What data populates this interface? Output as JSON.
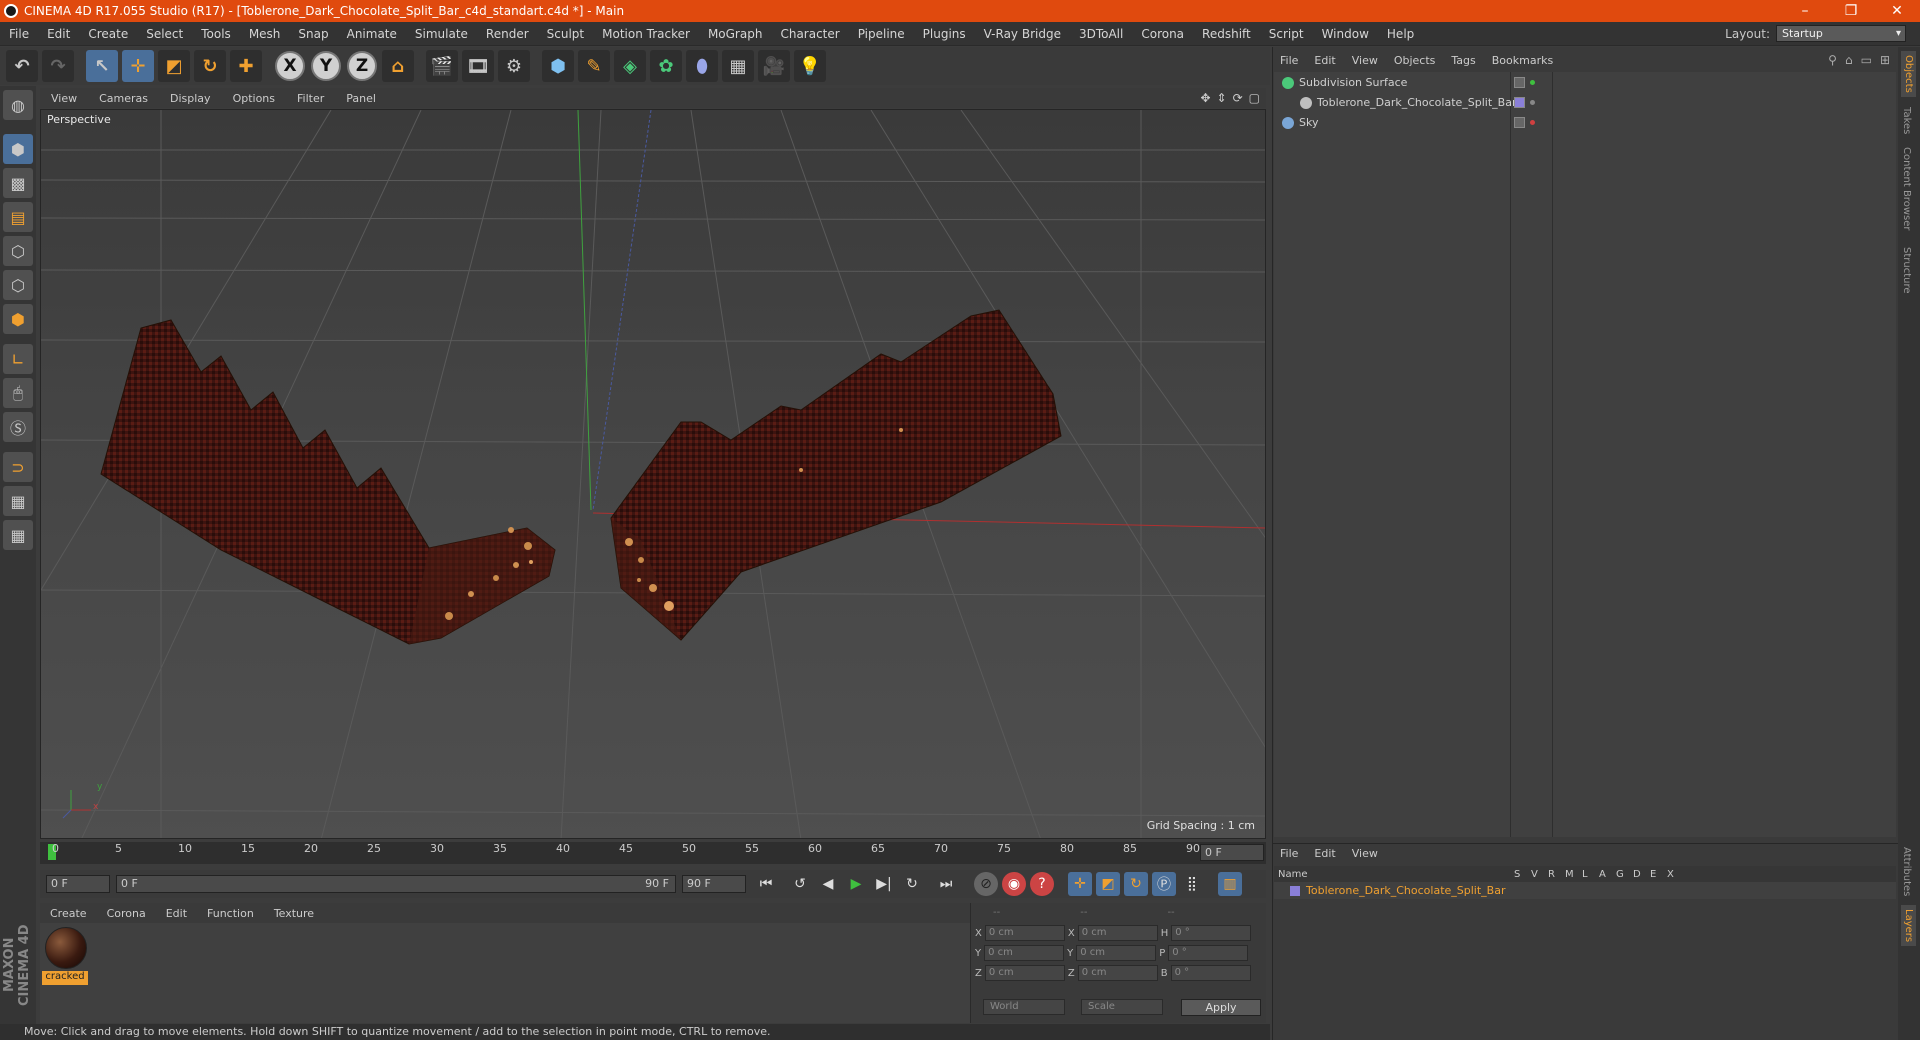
{
  "window": {
    "title": "CINEMA 4D R17.055 Studio (R17) - [Toblerone_Dark_Chocolate_Split_Bar_c4d_standart.c4d *] - Main",
    "controls": [
      "–",
      "❐",
      "✕"
    ]
  },
  "menubar": {
    "items": [
      "File",
      "Edit",
      "Create",
      "Select",
      "Tools",
      "Mesh",
      "Snap",
      "Animate",
      "Simulate",
      "Render",
      "Sculpt",
      "Motion Tracker",
      "MoGraph",
      "Character",
      "Pipeline",
      "Plugins",
      "V-Ray Bridge",
      "3DToAll",
      "Corona",
      "Redshift",
      "Script",
      "Window",
      "Help"
    ],
    "layout_label": "Layout:",
    "layout_value": "Startup"
  },
  "toolbar": {
    "undo_icon": "undo-icon",
    "redo_icon": "redo-icon",
    "axis_x": "X",
    "axis_y": "Y",
    "axis_z": "Z"
  },
  "viewport": {
    "menu": [
      "View",
      "Cameras",
      "Display",
      "Options",
      "Filter",
      "Panel"
    ],
    "camera_label": "Perspective",
    "grid_spacing": "Grid Spacing : 1 cm",
    "axis_x": "x",
    "axis_y": "y"
  },
  "timeline": {
    "ticks": [
      "0",
      "5",
      "10",
      "15",
      "20",
      "25",
      "30",
      "35",
      "40",
      "45",
      "50",
      "55",
      "60",
      "65",
      "70",
      "75",
      "80",
      "85",
      "90"
    ],
    "current_frame": "0 F",
    "start_field": "0 F",
    "range_start": "0 F",
    "range_end": "90 F",
    "end_field": "90 F"
  },
  "material_manager": {
    "menu": [
      "Create",
      "Corona",
      "Edit",
      "Function",
      "Texture"
    ],
    "material_name": "cracked"
  },
  "coordinates": {
    "header": [
      "--",
      "--",
      "--"
    ],
    "rows": [
      {
        "a": "X",
        "av": "0 cm",
        "b": "X",
        "bv": "0 cm",
        "c": "H",
        "cv": "0 °"
      },
      {
        "a": "Y",
        "av": "0 cm",
        "b": "Y",
        "bv": "0 cm",
        "c": "P",
        "cv": "0 °"
      },
      {
        "a": "Z",
        "av": "0 cm",
        "b": "Z",
        "bv": "0 cm",
        "c": "B",
        "cv": "0 °"
      }
    ],
    "space": "World",
    "mode": "Scale",
    "apply": "Apply"
  },
  "status": {
    "text": "Move: Click and drag to move elements. Hold down SHIFT to quantize movement / add to the selection in point mode, CTRL to remove."
  },
  "object_manager": {
    "menu": [
      "File",
      "Edit",
      "View",
      "Objects",
      "Tags",
      "Bookmarks"
    ],
    "objects": [
      {
        "name": "Subdivision Surface",
        "color": "#4bc97a"
      },
      {
        "name": "Toblerone_Dark_Chocolate_Split_Bar",
        "color": "#bfbfbf"
      },
      {
        "name": "Sky",
        "color": "#7aa6d6"
      }
    ]
  },
  "layer_manager": {
    "menu": [
      "File",
      "Edit",
      "View"
    ],
    "columns": [
      "Name",
      "S",
      "V",
      "R",
      "M",
      "L",
      "A",
      "G",
      "D",
      "E",
      "X"
    ],
    "layer_name": "Toblerone_Dark_Chocolate_Split_Bar",
    "layer_color": "#8a7fd8"
  },
  "side_tabs": [
    "Objects",
    "Takes",
    "Content Browser",
    "Structure"
  ],
  "side_tabs_bottom": [
    "Attributes",
    "Layers"
  ],
  "colors": {
    "titlebar": "#e04a0e",
    "accent": "#f0a030",
    "tool_blue": "#4a6f9a"
  }
}
